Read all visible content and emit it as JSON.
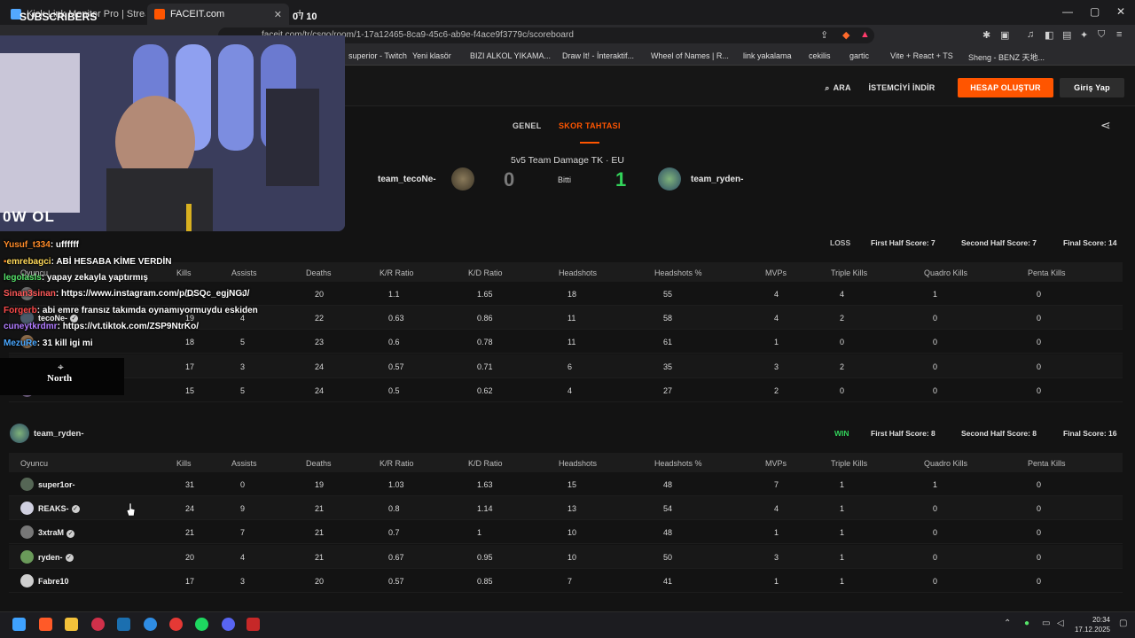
{
  "browser": {
    "tabs": [
      {
        "label": "Kick Link Monitor Pro | Stream Deck"
      },
      {
        "label": "FACEIT.com"
      }
    ],
    "url": "faceit.com/tr/csgo/room/1-17a12465-8ca9-45c6-ab9e-f4ace9f3779c/scoreboard",
    "bookmarks": [
      "superior - Twitch",
      "Yeni klasör",
      "BIZI ALKOL YIKAMA...",
      "Draw It! - İnteraktif...",
      "Wheel of Names | R...",
      "link yakalama",
      "cekilis",
      "gartic",
      "Vite + React + TS",
      "Sheng - BENZ 天地..."
    ]
  },
  "overlay": {
    "subscribers_label": "SUBSCRIBERS",
    "subscribers_count": "0 / 10",
    "logo_text": "0W OL",
    "north_text": "North",
    "chat": [
      {
        "user": "Yusuf_t334",
        "msg": "uffffff"
      },
      {
        "user": "emrebagci",
        "msg": "ABİ HESABA KİME VERDİN"
      },
      {
        "user": "legolasls",
        "msg": "yapay zekayla yaptırmış"
      },
      {
        "user": "Sinan3sinan",
        "msg": "https://www.instagram.com/p/DSQc_egjNGJ/"
      },
      {
        "user": "Forgerb",
        "msg": "abi emre fransız takımda oynamıyormuydu eskiden"
      },
      {
        "user": "cuneytkrdmr",
        "msg": "https://vt.tiktok.com/ZSP9NtrKo/"
      },
      {
        "user": "MezuRe",
        "msg": "31 kill igi mi"
      }
    ]
  },
  "header": {
    "search": "ARA",
    "download": "İSTEMCİYİ İNDİR",
    "signup": "HESAP OLUŞTUR",
    "login": "Giriş Yap"
  },
  "tabs": {
    "general": "GENEL",
    "scoreboard": "SKOR TAHTASI"
  },
  "match": {
    "title": "5v5 Team Damage TK · EU",
    "team1": "team_tecoNe-",
    "team2": "team_ryden-",
    "score1": "0",
    "score2": "1",
    "status": "Bitti"
  },
  "columns": [
    "Oyuncu",
    "Kills",
    "Assists",
    "Deaths",
    "K/R Ratio",
    "K/D Ratio",
    "Headshots",
    "Headshots %",
    "MVPs",
    "Triple Kills",
    "Quadro Kills",
    "Penta Kills"
  ],
  "team1_table": {
    "name": "team_tecoNe-",
    "result": "LOSS",
    "first_half": "First Half Score: 7",
    "second_half": "Second Half Score: 7",
    "final": "Final Score: 14",
    "rows": [
      {
        "player": "",
        "verified": false,
        "stats": [
          "24",
          "4",
          "20",
          "1.1",
          "1.65",
          "18",
          "55",
          "4",
          "4",
          "1",
          "0"
        ]
      },
      {
        "player": "tecoNe-",
        "verified": true,
        "stats": [
          "19",
          "4",
          "22",
          "0.63",
          "0.86",
          "11",
          "58",
          "4",
          "2",
          "0",
          "0"
        ]
      },
      {
        "player": "",
        "verified": false,
        "stats": [
          "18",
          "5",
          "23",
          "0.6",
          "0.78",
          "11",
          "61",
          "1",
          "0",
          "0",
          "0"
        ]
      },
      {
        "player": "",
        "verified": false,
        "stats": [
          "17",
          "3",
          "24",
          "0.57",
          "0.71",
          "6",
          "35",
          "3",
          "2",
          "0",
          "0"
        ]
      },
      {
        "player": "",
        "verified": false,
        "stats": [
          "15",
          "5",
          "24",
          "0.5",
          "0.62",
          "4",
          "27",
          "2",
          "0",
          "0",
          "0"
        ]
      }
    ]
  },
  "team2_table": {
    "name": "team_ryden-",
    "result": "WIN",
    "first_half": "First Half Score: 8",
    "second_half": "Second Half Score: 8",
    "final": "Final Score: 16",
    "rows": [
      {
        "player": "super1or-",
        "verified": false,
        "stats": [
          "31",
          "0",
          "19",
          "1.03",
          "1.63",
          "15",
          "48",
          "7",
          "1",
          "1",
          "0"
        ]
      },
      {
        "player": "REAKS-",
        "verified": true,
        "stats": [
          "24",
          "9",
          "21",
          "0.8",
          "1.14",
          "13",
          "54",
          "4",
          "1",
          "0",
          "0"
        ]
      },
      {
        "player": "3xtraM",
        "verified": true,
        "stats": [
          "21",
          "7",
          "21",
          "0.7",
          "1",
          "10",
          "48",
          "1",
          "1",
          "0",
          "0"
        ]
      },
      {
        "player": "ryden-",
        "verified": true,
        "stats": [
          "20",
          "4",
          "21",
          "0.67",
          "0.95",
          "10",
          "50",
          "3",
          "1",
          "0",
          "0"
        ]
      },
      {
        "player": "Fabre10",
        "verified": false,
        "stats": [
          "17",
          "3",
          "20",
          "0.57",
          "0.85",
          "7",
          "41",
          "1",
          "1",
          "0",
          "0"
        ]
      }
    ]
  },
  "taskbar": {
    "time": "20:34",
    "date": "17.12.2025"
  },
  "colors": {
    "accent": "#ff5500",
    "win": "#32d35a"
  }
}
